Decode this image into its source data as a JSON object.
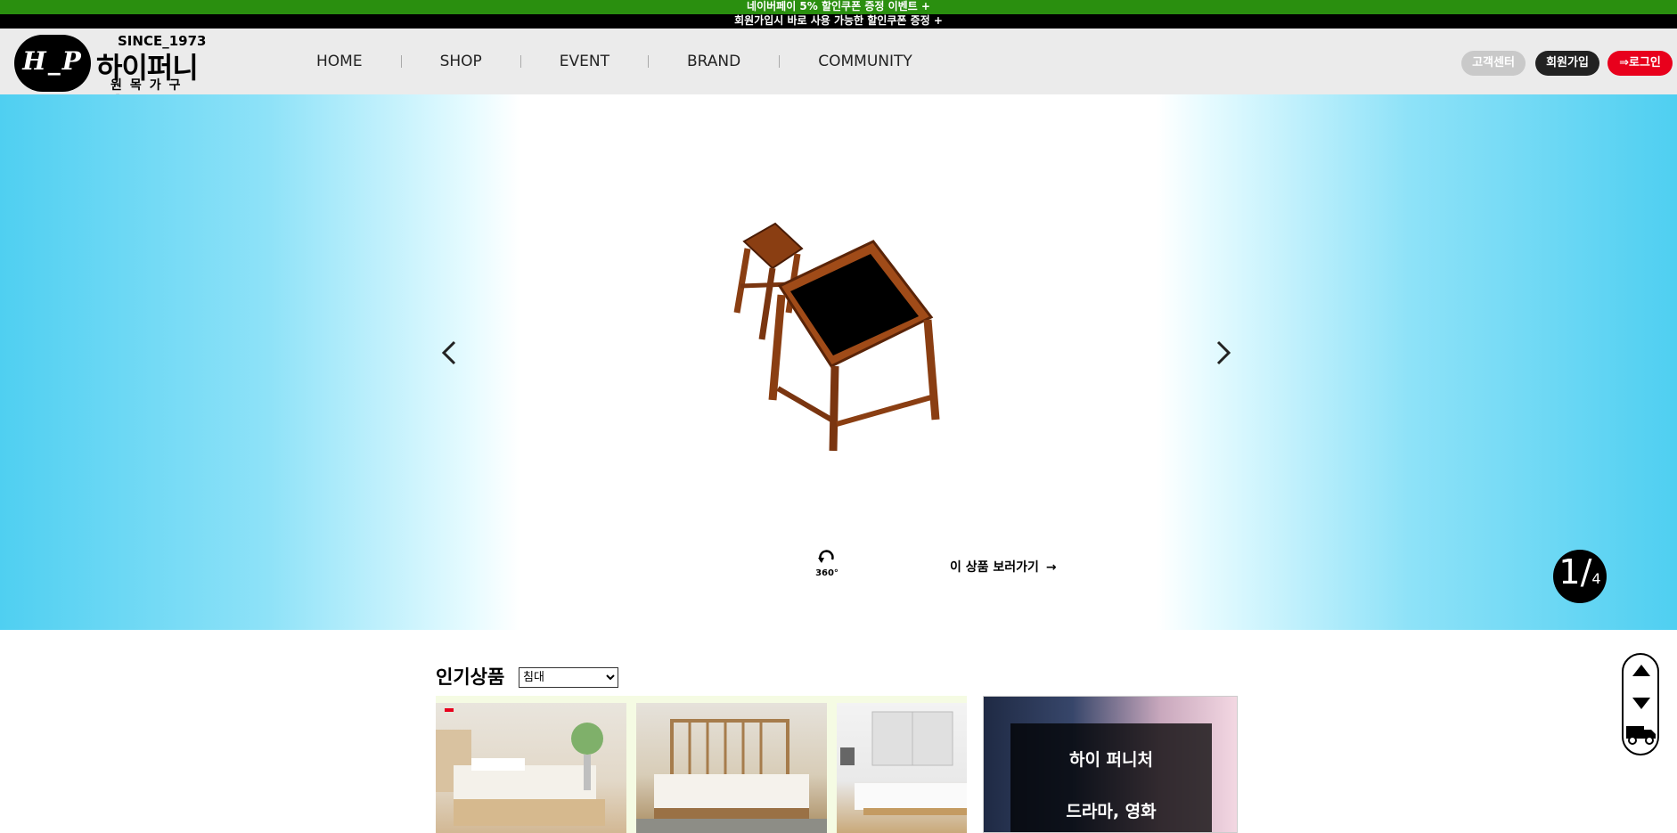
{
  "announcements": {
    "line1": "네이버페이 5% 할인쿠폰 증정 이벤트 +",
    "line2": "회원가입시 바로 사용 가능한 할인쿠폰 증정 +"
  },
  "logo": {
    "mark": "H_P",
    "since": "SINCE_1973",
    "name": "하이퍼니처",
    "sub": "원목가구"
  },
  "nav": [
    {
      "label": "HOME"
    },
    {
      "label": "SHOP"
    },
    {
      "label": "EVENT"
    },
    {
      "label": "BRAND"
    },
    {
      "label": "COMMUNITY"
    }
  ],
  "utility": {
    "customer_center": "고객센터",
    "join": "회원가입",
    "login": "⇒로그인"
  },
  "hero": {
    "rotate_label": "360°",
    "go_product": "이 상품 보러가기",
    "go_arrow": "→",
    "slide_current": "1",
    "slide_sep": "/",
    "slide_total": "4",
    "prev_icon": "chevron-left-icon",
    "next_icon": "chevron-right-icon"
  },
  "popular": {
    "title": "인기상품",
    "category_selected": "침대"
  },
  "media_banner": {
    "title": "하이 퍼니처",
    "subtitle": "드라마, 영화"
  },
  "colors": {
    "announce_green": "#2a8f0f",
    "login_red": "#e8001c",
    "hero_cyan": "#4fcff1"
  }
}
